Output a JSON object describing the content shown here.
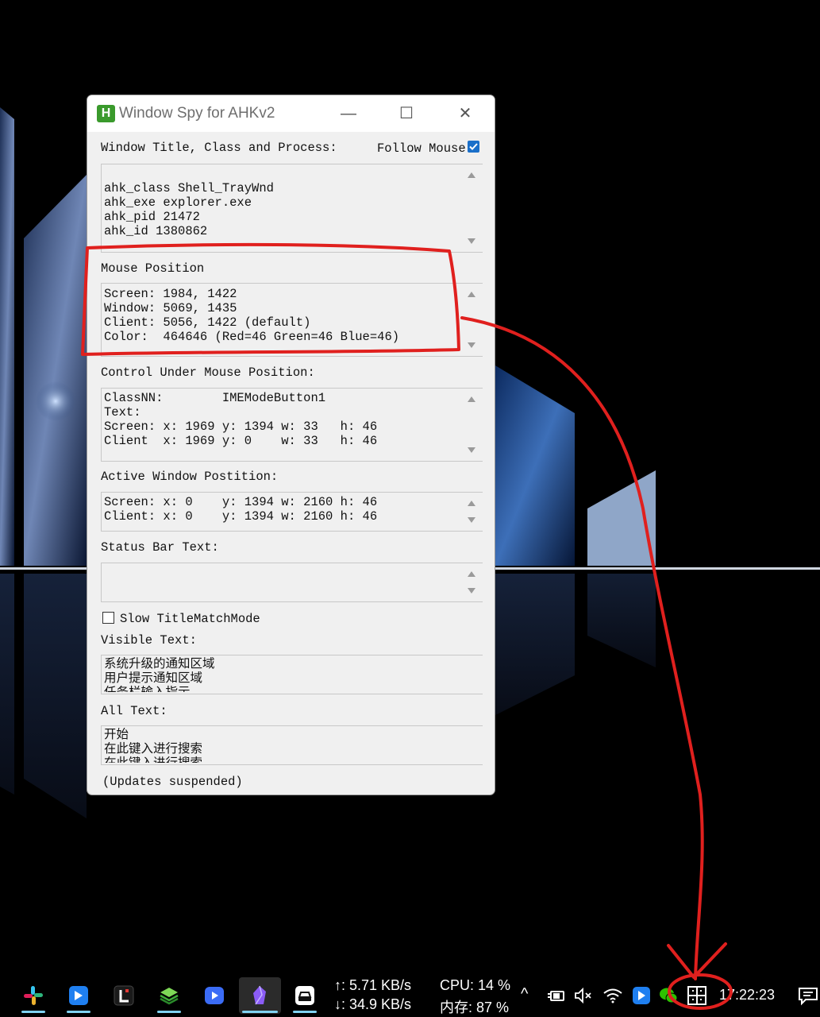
{
  "window": {
    "title": "Window Spy for AHKv2",
    "app_icon_letter": "H",
    "minimize_glyph": "—",
    "maximize_glyph": "☐",
    "close_glyph": "✕"
  },
  "sections": {
    "window_title": {
      "label": "Window Title, Class and Process:",
      "follow_mouse_label": "Follow Mouse",
      "follow_mouse_checked": true,
      "lines": [
        "",
        "ahk_class Shell_TrayWnd",
        "ahk_exe explorer.exe",
        "ahk_pid 21472",
        "ahk_id 1380862"
      ]
    },
    "mouse_position": {
      "label": "Mouse Position",
      "lines": [
        "Screen: 1984, 1422",
        "Window: 5069, 1435",
        "Client: 5056, 1422 (default)",
        "Color:  464646 (Red=46 Green=46 Blue=46)"
      ]
    },
    "control": {
      "label": "Control Under Mouse Position:",
      "lines": [
        "ClassNN:        IMEModeButton1",
        "Text:",
        "Screen: x: 1969 y: 1394 w: 33   h: 46",
        "Client  x: 1969 y: 0    w: 33   h: 46"
      ]
    },
    "active_window": {
      "label": "Active Window Postition:",
      "lines": [
        "Screen: x: 0    y: 1394 w: 2160 h: 46",
        "Client: x: 0    y: 1394 w: 2160 h: 46"
      ]
    },
    "status_bar": {
      "label": "Status Bar Text:",
      "lines": []
    },
    "slow_mode": {
      "label": "Slow TitleMatchMode",
      "checked": false
    },
    "visible_text": {
      "label": "Visible Text:",
      "lines": [
        "系统升级的通知区域",
        "用户提示通知区域",
        "任务栏输入指示"
      ]
    },
    "all_text": {
      "label": "All Text:",
      "lines": [
        "开始",
        "在此键入进行搜索",
        "在此键入进行搜索"
      ]
    },
    "footer": "(Updates suspended)"
  },
  "taskbar": {
    "net_up": "↑: 5.71 KB/s",
    "net_down": "↓: 34.9 KB/s",
    "cpu": "CPU: 14 %",
    "mem": "内存: 87 %",
    "time": "17:22:23",
    "chevron_glyph": "^",
    "apps": [
      "slack-icon",
      "feishu-icon",
      "l-app-icon",
      "layers-app-icon",
      "video-player-icon",
      "obsidian-icon",
      "car-app-icon"
    ],
    "tray": [
      "power-icon",
      "mute-icon",
      "wifi-icon",
      "feishu-tray-icon",
      "wechat-icon",
      "ime-mode-icon",
      "notification-icon"
    ]
  },
  "colors": {
    "annotation_red": "#e0201e",
    "window_bg": "#f0f0f0",
    "checkbox_blue": "#1a6fc9",
    "app_icon_green": "#3a9a2c"
  }
}
